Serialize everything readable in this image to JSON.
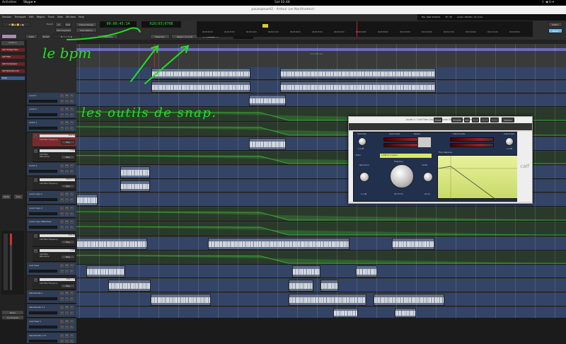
{
  "topbar": {
    "activities": "Activities",
    "app": "Skype ▾",
    "clock": "Sat 02:48"
  },
  "window": {
    "title": "pauarpauart2 - Ardour (on Nordinateur)"
  },
  "menu": [
    "Session",
    "Transport",
    "Edit",
    "Region",
    "Track",
    "View",
    "Window",
    "Help"
  ],
  "status": {
    "file": "File: WAV 16 Bold",
    "tc": "TC: 30",
    "audio": "Audio: 48 kHz / 21.3 ms",
    "buffers": "Buffers: p100% c100%",
    "dsp": "DSP: 12%",
    "disk": "Disk: >24 hrs",
    "time": "02:48"
  },
  "toolbar": {
    "punch": "Punch",
    "in": "In",
    "out": "Out",
    "follow_range": "Follow Range",
    "auto_return": "Auto Return",
    "non_layered": "Non-Layered",
    "int_mark": "Int. Marks",
    "clock_primary": "00:00:45:14",
    "clock_secondary": "026|03|0708",
    "mode": "Slide",
    "grid": "Smart",
    "edit_point": "Playhead",
    "snap": "Magnetic",
    "snap_to": "Region bounds",
    "edit_mode": "Mouse",
    "nudge_clock": "00:00:01:00",
    "editor": "Editor",
    "mixer": "Mixer"
  },
  "ruler": {
    "ticks": [
      "00:00:00:00",
      "00:00:07:00",
      "00:00:14:00",
      "00:00:21:00",
      "00:00:28:00",
      "00:00:35:00",
      "00:00:42:00",
      "00:00:49:00",
      "00:00:56:00",
      "00:01:03:00",
      "00:01:10:00",
      "00:01:17:00",
      "00:01:24:00",
      "00:01:31:00",
      "00:01:38:00"
    ],
    "tempo_marker": "120.000 4/4"
  },
  "left_list": {
    "header": "Audio 1",
    "items": [
      "Calf Vintage Dela",
      "Calf Filter",
      "Calf Compressor",
      "Calf Sidechain Lim",
      "Fader"
    ],
    "buttons": [
      "In",
      "Disk",
      "Iso",
      "Lock",
      "Mute",
      "Solo",
      "Mixer",
      "Comments"
    ],
    "meter_scale": [
      "-inf",
      "-3",
      "-6",
      "-10",
      "-15",
      "-20",
      "-30",
      "-40",
      "-50"
    ]
  },
  "tracks": [
    {
      "name": "vocal 1",
      "type": "track"
    },
    {
      "name": "vocal 2",
      "type": "track"
    },
    {
      "name": "Audio 1",
      "type": "track"
    },
    {
      "name": "Calf Filter Frequency",
      "value": "39.8 Hz",
      "mode": "Play",
      "type": "auto",
      "active": true
    },
    {
      "name": "Calf Filter Resonance",
      "value": "1.000",
      "mode": "Play",
      "type": "auto"
    },
    {
      "name": "Audio 2",
      "type": "track"
    },
    {
      "name": "Calf Filter Frequency",
      "value": "6820.0 Hz",
      "mode": "Play",
      "type": "auto"
    },
    {
      "name": "vocal copy 1",
      "type": "track"
    },
    {
      "name": "vocal copy 2",
      "type": "track"
    },
    {
      "name": "vocal copy effectives",
      "type": "track"
    },
    {
      "name": "Calf Filter Frequency",
      "value": "39.8 Hz",
      "mode": "Play",
      "type": "auto"
    },
    {
      "name": "Calf Filter Resonance",
      "value": "1.000",
      "mode": "Play",
      "type": "auto"
    },
    {
      "name": "voix hess",
      "type": "track"
    },
    {
      "name": "Calf Filter Frequency",
      "value": "3580.7 Hz",
      "mode": "Play",
      "type": "auto"
    },
    {
      "name": "disonbeute 1",
      "type": "track"
    },
    {
      "name": "disonbeute 1.1",
      "type": "track"
    },
    {
      "name": "voix hess 1",
      "type": "track"
    },
    {
      "name": "disonbeute 1.11",
      "type": "track"
    }
  ],
  "plugin": {
    "title": "Audio 1: Calf Filter (by Calf Studio Gear) on Nordinateur",
    "preset": "Preset",
    "presets": "Presets",
    "add": "Add",
    "save": "Save",
    "delete": "Delete",
    "reset": "Reset",
    "bypass": "Bypass",
    "input_gain": "Input Gain",
    "input_levels": "Input Levels",
    "output_levels": "Output Levels",
    "output_gain": "Output Gain",
    "bypass_label": "Bypass",
    "mode_label": "Mode",
    "mode_value": "12dB/oct Lowpass",
    "freq_response": "Freq. Response",
    "resonance": "Resonance",
    "frequency": "Frequency",
    "inertia": "Inertia",
    "in_gain_val": "1.2 dB",
    "out_gain_val": "1.2 dB",
    "res_val": "1.2 dB",
    "freq_val": "39.777 Hz",
    "inertia_val": "20 ms",
    "brand": "calf"
  },
  "annotations": {
    "bpm": "le bpm",
    "snap": "les outils de snap."
  }
}
